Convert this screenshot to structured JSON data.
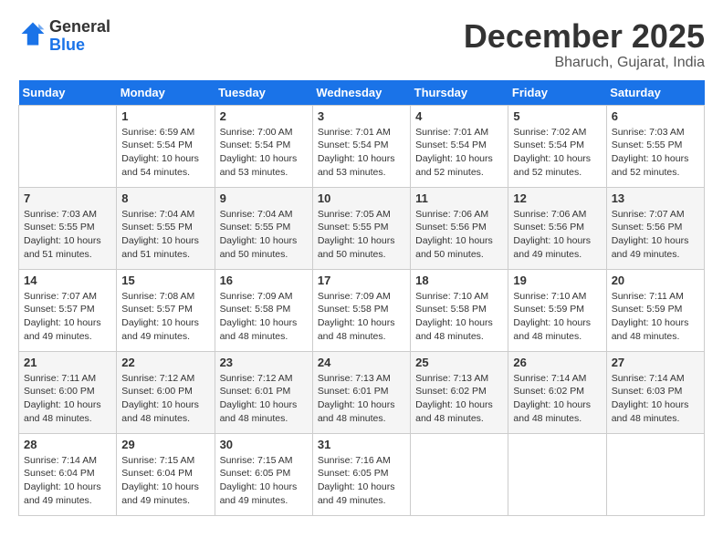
{
  "header": {
    "logo_line1": "General",
    "logo_line2": "Blue",
    "month": "December 2025",
    "location": "Bharuch, Gujarat, India"
  },
  "weekdays": [
    "Sunday",
    "Monday",
    "Tuesday",
    "Wednesday",
    "Thursday",
    "Friday",
    "Saturday"
  ],
  "weeks": [
    [
      {
        "day": "",
        "info": ""
      },
      {
        "day": "1",
        "info": "Sunrise: 6:59 AM\nSunset: 5:54 PM\nDaylight: 10 hours\nand 54 minutes."
      },
      {
        "day": "2",
        "info": "Sunrise: 7:00 AM\nSunset: 5:54 PM\nDaylight: 10 hours\nand 53 minutes."
      },
      {
        "day": "3",
        "info": "Sunrise: 7:01 AM\nSunset: 5:54 PM\nDaylight: 10 hours\nand 53 minutes."
      },
      {
        "day": "4",
        "info": "Sunrise: 7:01 AM\nSunset: 5:54 PM\nDaylight: 10 hours\nand 52 minutes."
      },
      {
        "day": "5",
        "info": "Sunrise: 7:02 AM\nSunset: 5:54 PM\nDaylight: 10 hours\nand 52 minutes."
      },
      {
        "day": "6",
        "info": "Sunrise: 7:03 AM\nSunset: 5:55 PM\nDaylight: 10 hours\nand 52 minutes."
      }
    ],
    [
      {
        "day": "7",
        "info": "Sunrise: 7:03 AM\nSunset: 5:55 PM\nDaylight: 10 hours\nand 51 minutes."
      },
      {
        "day": "8",
        "info": "Sunrise: 7:04 AM\nSunset: 5:55 PM\nDaylight: 10 hours\nand 51 minutes."
      },
      {
        "day": "9",
        "info": "Sunrise: 7:04 AM\nSunset: 5:55 PM\nDaylight: 10 hours\nand 50 minutes."
      },
      {
        "day": "10",
        "info": "Sunrise: 7:05 AM\nSunset: 5:55 PM\nDaylight: 10 hours\nand 50 minutes."
      },
      {
        "day": "11",
        "info": "Sunrise: 7:06 AM\nSunset: 5:56 PM\nDaylight: 10 hours\nand 50 minutes."
      },
      {
        "day": "12",
        "info": "Sunrise: 7:06 AM\nSunset: 5:56 PM\nDaylight: 10 hours\nand 49 minutes."
      },
      {
        "day": "13",
        "info": "Sunrise: 7:07 AM\nSunset: 5:56 PM\nDaylight: 10 hours\nand 49 minutes."
      }
    ],
    [
      {
        "day": "14",
        "info": "Sunrise: 7:07 AM\nSunset: 5:57 PM\nDaylight: 10 hours\nand 49 minutes."
      },
      {
        "day": "15",
        "info": "Sunrise: 7:08 AM\nSunset: 5:57 PM\nDaylight: 10 hours\nand 49 minutes."
      },
      {
        "day": "16",
        "info": "Sunrise: 7:09 AM\nSunset: 5:58 PM\nDaylight: 10 hours\nand 48 minutes."
      },
      {
        "day": "17",
        "info": "Sunrise: 7:09 AM\nSunset: 5:58 PM\nDaylight: 10 hours\nand 48 minutes."
      },
      {
        "day": "18",
        "info": "Sunrise: 7:10 AM\nSunset: 5:58 PM\nDaylight: 10 hours\nand 48 minutes."
      },
      {
        "day": "19",
        "info": "Sunrise: 7:10 AM\nSunset: 5:59 PM\nDaylight: 10 hours\nand 48 minutes."
      },
      {
        "day": "20",
        "info": "Sunrise: 7:11 AM\nSunset: 5:59 PM\nDaylight: 10 hours\nand 48 minutes."
      }
    ],
    [
      {
        "day": "21",
        "info": "Sunrise: 7:11 AM\nSunset: 6:00 PM\nDaylight: 10 hours\nand 48 minutes."
      },
      {
        "day": "22",
        "info": "Sunrise: 7:12 AM\nSunset: 6:00 PM\nDaylight: 10 hours\nand 48 minutes."
      },
      {
        "day": "23",
        "info": "Sunrise: 7:12 AM\nSunset: 6:01 PM\nDaylight: 10 hours\nand 48 minutes."
      },
      {
        "day": "24",
        "info": "Sunrise: 7:13 AM\nSunset: 6:01 PM\nDaylight: 10 hours\nand 48 minutes."
      },
      {
        "day": "25",
        "info": "Sunrise: 7:13 AM\nSunset: 6:02 PM\nDaylight: 10 hours\nand 48 minutes."
      },
      {
        "day": "26",
        "info": "Sunrise: 7:14 AM\nSunset: 6:02 PM\nDaylight: 10 hours\nand 48 minutes."
      },
      {
        "day": "27",
        "info": "Sunrise: 7:14 AM\nSunset: 6:03 PM\nDaylight: 10 hours\nand 48 minutes."
      }
    ],
    [
      {
        "day": "28",
        "info": "Sunrise: 7:14 AM\nSunset: 6:04 PM\nDaylight: 10 hours\nand 49 minutes."
      },
      {
        "day": "29",
        "info": "Sunrise: 7:15 AM\nSunset: 6:04 PM\nDaylight: 10 hours\nand 49 minutes."
      },
      {
        "day": "30",
        "info": "Sunrise: 7:15 AM\nSunset: 6:05 PM\nDaylight: 10 hours\nand 49 minutes."
      },
      {
        "day": "31",
        "info": "Sunrise: 7:16 AM\nSunset: 6:05 PM\nDaylight: 10 hours\nand 49 minutes."
      },
      {
        "day": "",
        "info": ""
      },
      {
        "day": "",
        "info": ""
      },
      {
        "day": "",
        "info": ""
      }
    ]
  ]
}
